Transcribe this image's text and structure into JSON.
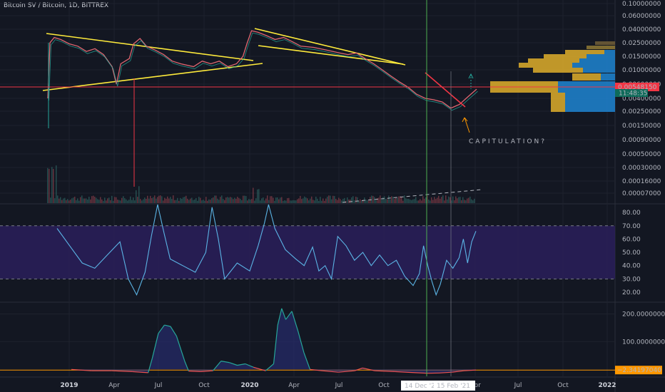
{
  "chart_data": {
    "type": "line",
    "title": "Bitcoin SV / Bitcoin, 1D, BITTREX",
    "x_tick_labels": [
      "2019",
      "Apr",
      "Jul",
      "Oct",
      "2020",
      "Apr",
      "Jul",
      "Oct",
      "Apr",
      "Jul",
      "Oct",
      "2022"
    ],
    "x_tick_bold": [
      true,
      false,
      false,
      false,
      true,
      false,
      false,
      false,
      false,
      false,
      false,
      true
    ],
    "x_crosshair_labels": [
      "14 Dec '20",
      "15 Feb '21"
    ],
    "price_axis": {
      "scale": "log",
      "tick_labels": [
        "0.10000000",
        "0.06000000",
        "0.04000000",
        "0.02500000",
        "0.01500000",
        "0.01000000",
        "0.00600000",
        "0.00400000",
        "0.00250000",
        "0.00150000",
        "0.00090000",
        "0.00050000",
        "0.00030000",
        "0.00016000",
        "0.00007000"
      ],
      "current_price_label": "0.00548150",
      "countdown_label": "11:48:35"
    },
    "annotation": "CAPITULATION?",
    "rsi": {
      "tick_labels": [
        "80.00",
        "70.00",
        "60.00",
        "50.00",
        "40.00",
        "30.00",
        "20.00"
      ],
      "band": [
        30,
        70
      ],
      "ylim": [
        13,
        86
      ],
      "series": [
        [
          0.0,
          68
        ],
        [
          0.03,
          55
        ],
        [
          0.06,
          42
        ],
        [
          0.09,
          38
        ],
        [
          0.12,
          48
        ],
        [
          0.15,
          58
        ],
        [
          0.17,
          30
        ],
        [
          0.19,
          18
        ],
        [
          0.21,
          35
        ],
        [
          0.225,
          62
        ],
        [
          0.24,
          86
        ],
        [
          0.255,
          65
        ],
        [
          0.27,
          45
        ],
        [
          0.3,
          40
        ],
        [
          0.33,
          35
        ],
        [
          0.355,
          50
        ],
        [
          0.37,
          84
        ],
        [
          0.385,
          60
        ],
        [
          0.4,
          30
        ],
        [
          0.43,
          42
        ],
        [
          0.46,
          36
        ],
        [
          0.48,
          55
        ],
        [
          0.495,
          72
        ],
        [
          0.505,
          86
        ],
        [
          0.52,
          68
        ],
        [
          0.545,
          52
        ],
        [
          0.57,
          45
        ],
        [
          0.59,
          40
        ],
        [
          0.61,
          54
        ],
        [
          0.625,
          36
        ],
        [
          0.64,
          40
        ],
        [
          0.655,
          30
        ],
        [
          0.67,
          62
        ],
        [
          0.69,
          55
        ],
        [
          0.71,
          44
        ],
        [
          0.73,
          50
        ],
        [
          0.75,
          40
        ],
        [
          0.77,
          48
        ],
        [
          0.79,
          40
        ],
        [
          0.81,
          44
        ],
        [
          0.83,
          32
        ],
        [
          0.85,
          25
        ],
        [
          0.865,
          34
        ],
        [
          0.875,
          55
        ],
        [
          0.885,
          40
        ],
        [
          0.895,
          28
        ],
        [
          0.905,
          18
        ],
        [
          0.915,
          26
        ],
        [
          0.93,
          44
        ],
        [
          0.945,
          38
        ],
        [
          0.96,
          46
        ],
        [
          0.97,
          60
        ],
        [
          0.98,
          42
        ],
        [
          0.99,
          58
        ],
        [
          1.0,
          66
        ]
      ],
      "color": "#5bb4e5"
    },
    "oscillator": {
      "tick_labels": [
        "200.00000000",
        "100.00000000"
      ],
      "current_value_label": "−2.34197040",
      "ylim": [
        -25,
        240
      ],
      "series": [
        [
          0.0,
          0
        ],
        [
          0.05,
          -5
        ],
        [
          0.1,
          -5
        ],
        [
          0.15,
          -8
        ],
        [
          0.19,
          -12
        ],
        [
          0.2,
          40
        ],
        [
          0.215,
          130
        ],
        [
          0.23,
          160
        ],
        [
          0.245,
          155
        ],
        [
          0.26,
          120
        ],
        [
          0.28,
          30
        ],
        [
          0.29,
          -6
        ],
        [
          0.32,
          -8
        ],
        [
          0.35,
          -5
        ],
        [
          0.37,
          30
        ],
        [
          0.39,
          25
        ],
        [
          0.41,
          15
        ],
        [
          0.43,
          20
        ],
        [
          0.45,
          8
        ],
        [
          0.48,
          -5
        ],
        [
          0.5,
          20
        ],
        [
          0.51,
          160
        ],
        [
          0.52,
          220
        ],
        [
          0.53,
          180
        ],
        [
          0.545,
          210
        ],
        [
          0.56,
          140
        ],
        [
          0.575,
          60
        ],
        [
          0.59,
          0
        ],
        [
          0.62,
          -5
        ],
        [
          0.66,
          -10
        ],
        [
          0.7,
          -5
        ],
        [
          0.72,
          5
        ],
        [
          0.75,
          -5
        ],
        [
          0.8,
          -8
        ],
        [
          0.85,
          -12
        ],
        [
          0.88,
          -14
        ],
        [
          0.91,
          -13
        ],
        [
          0.94,
          -10
        ],
        [
          0.97,
          -5
        ],
        [
          1.0,
          -2.34
        ]
      ],
      "color_positive": "#26a69a",
      "color_negative": "#ef5350"
    },
    "colors": {
      "background": "#131722",
      "trendlines": "#ffeb3b",
      "price_line": "#f23645",
      "crosshair": "#4caf50",
      "annotation": "#ff9800",
      "rsi_band": "#2a1f5a"
    }
  }
}
